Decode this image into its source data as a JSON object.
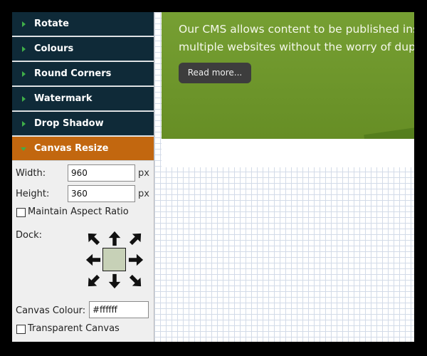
{
  "accordion": {
    "items": [
      {
        "label": "Rotate",
        "active": false
      },
      {
        "label": "Colours",
        "active": false
      },
      {
        "label": "Round Corners",
        "active": false
      },
      {
        "label": "Watermark",
        "active": false
      },
      {
        "label": "Drop Shadow",
        "active": false
      },
      {
        "label": "Canvas Resize",
        "active": true
      }
    ]
  },
  "canvas_resize": {
    "width_label": "Width:",
    "width_value": "960",
    "width_unit": "px",
    "height_label": "Height:",
    "height_value": "360",
    "height_unit": "px",
    "aspect_label": "Maintain Aspect Ratio",
    "aspect_checked": false,
    "dock_label": "Dock:",
    "dock_selected": "center",
    "canvas_colour_label": "Canvas Colour:",
    "canvas_colour_value": "#ffffff",
    "transparent_label": "Transparent Canvas",
    "transparent_checked": false
  },
  "preview": {
    "line1": "Our CMS allows content to be published instan",
    "line2": "multiple websites without the worry of duplica",
    "read_more": "Read more..."
  },
  "colors": {
    "accordion_bg": "#0f2a38",
    "accordion_active": "#c2670f",
    "arrow": "#3fae49",
    "slide_bg": "#6f9a28"
  },
  "icons": [
    "arrow-up-left-icon",
    "arrow-up-icon",
    "arrow-up-right-icon",
    "arrow-left-icon",
    "arrow-right-icon",
    "arrow-down-left-icon",
    "arrow-down-icon",
    "arrow-down-right-icon"
  ]
}
